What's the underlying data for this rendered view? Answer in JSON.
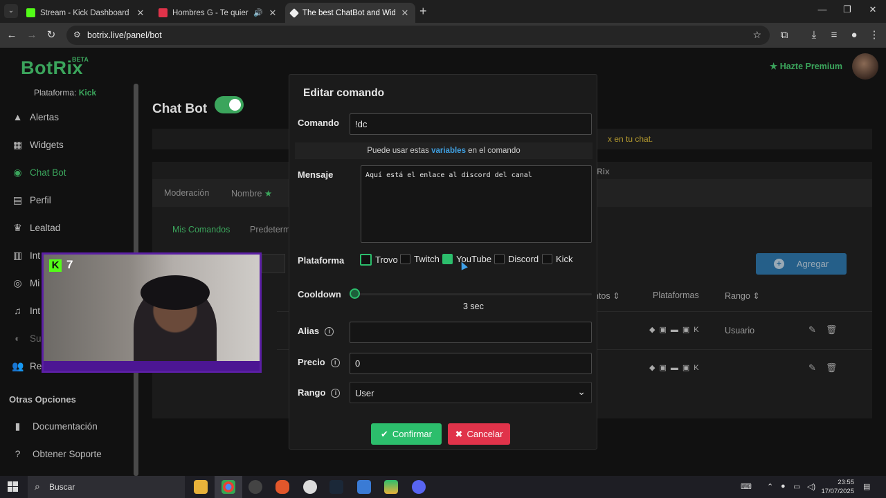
{
  "browser": {
    "tabs": [
      {
        "title": "Stream - Kick Dashboard",
        "favicon": "kick-icon",
        "color": "#53fc18"
      },
      {
        "title": "Hombres G - Te quiero (Au",
        "favicon": "youtube-icon",
        "color": "#e0334a"
      },
      {
        "title": "The best ChatBot and Widgets",
        "favicon": "botrix-icon",
        "color": "#eeeeee"
      }
    ],
    "url": "botrix.live/panel/bot"
  },
  "sidebar": {
    "logo": "BotRix",
    "beta": "BETA",
    "platform_label": "Plataforma:",
    "platform_value": "Kick",
    "items": [
      {
        "label": "Alertas",
        "icon": "warning-icon"
      },
      {
        "label": "Widgets",
        "icon": "grid-icon"
      },
      {
        "label": "Chat Bot",
        "icon": "gamepad-icon"
      },
      {
        "label": "Perfil",
        "icon": "id-card-icon"
      },
      {
        "label": "Lealtad",
        "icon": "trophy-icon"
      },
      {
        "label": "Int",
        "icon": "layers-icon"
      },
      {
        "label": "Mi",
        "icon": "controller-icon"
      },
      {
        "label": "Int",
        "icon": "music-icon"
      },
      {
        "label": "Su",
        "icon": "coins-icon"
      },
      {
        "label": "Re",
        "icon": "users-icon"
      }
    ],
    "section_other": "Otras Opciones",
    "other_items": [
      {
        "label": "Documentación",
        "icon": "book-icon"
      },
      {
        "label": "Obtener Soporte",
        "icon": "question-icon"
      }
    ]
  },
  "header": {
    "premium": "Hazte Premium"
  },
  "background": {
    "title": "Chat Bot",
    "banner_text": "x en tu chat.",
    "panel_text": "Rix",
    "tabs": [
      "Moderación",
      "Nombre"
    ],
    "subtabs": [
      "Mis Comandos",
      "Predeterm"
    ],
    "add_button": "Agregar",
    "columns": [
      "ntos",
      "Plataformas",
      "Rango"
    ],
    "row_rango": "Usuario"
  },
  "webcam": {
    "viewer_count": "7"
  },
  "modal": {
    "title": "Editar comando",
    "command_label": "Comando",
    "command_value": "!dc",
    "variables_prefix": "Puede usar estas",
    "variables_link": "variables",
    "variables_suffix": "en el comando",
    "message_label": "Mensaje",
    "message_value": "Aquí está el enlace al discord del canal",
    "platform_label": "Plataforma",
    "platforms": [
      {
        "name": "Trovo",
        "checked": false,
        "focused": true
      },
      {
        "name": "Twitch",
        "checked": false,
        "focused": false
      },
      {
        "name": "YouTube",
        "checked": true,
        "focused": false
      },
      {
        "name": "Discord",
        "checked": false,
        "focused": false
      },
      {
        "name": "Kick",
        "checked": false,
        "focused": false
      }
    ],
    "cooldown_label": "Cooldown",
    "cooldown_value": "3 sec",
    "alias_label": "Alias",
    "alias_value": "",
    "price_label": "Precio",
    "price_value": "0",
    "rank_label": "Rango",
    "rank_value": "User",
    "confirm_label": "Confirmar",
    "cancel_label": "Cancelar"
  },
  "taskbar": {
    "search_placeholder": "Buscar",
    "time": "23:55",
    "date": "17/07/2025"
  }
}
